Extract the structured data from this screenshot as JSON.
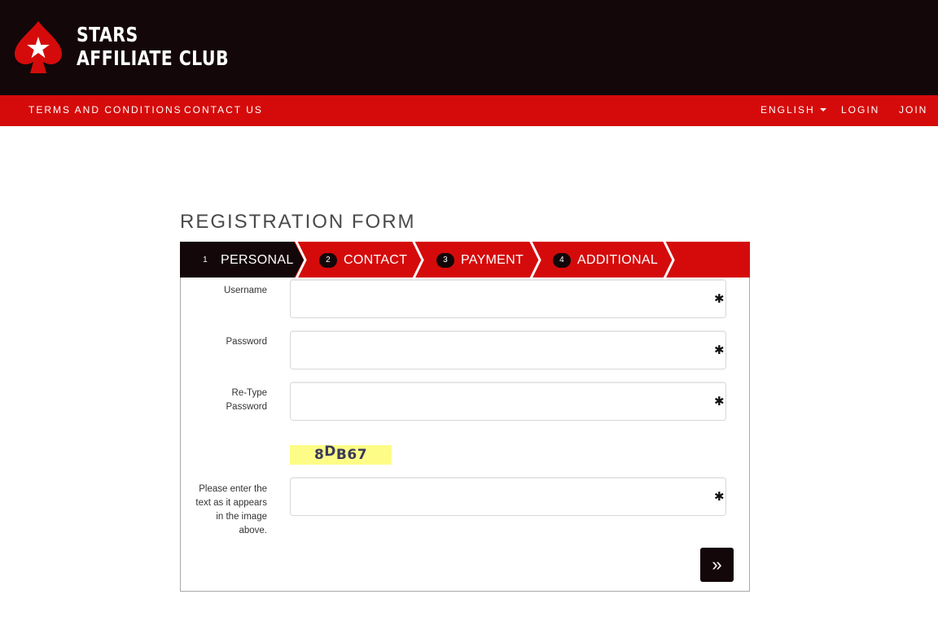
{
  "brand": {
    "line1": "STARS",
    "line2": "AFFILIATE CLUB",
    "logo_icon": "spade-star-icon"
  },
  "colors": {
    "header_bg": "#130709",
    "accent_red": "#d50b0b",
    "captcha_bg": "#fdfc86"
  },
  "nav": {
    "terms": "TERMS AND CONDITIONS",
    "contact": "CONTACT US",
    "language": "ENGLISH",
    "login": "LOGIN",
    "join": "JOIN"
  },
  "form": {
    "title": "REGISTRATION FORM",
    "steps": [
      {
        "number": "1",
        "label": "PERSONAL",
        "active": true
      },
      {
        "number": "2",
        "label": "CONTACT",
        "active": false
      },
      {
        "number": "3",
        "label": "PAYMENT",
        "active": false
      },
      {
        "number": "4",
        "label": "ADDITIONAL",
        "active": false
      }
    ],
    "fields": {
      "username": {
        "label": "Username",
        "value": ""
      },
      "password": {
        "label": "Password",
        "value": ""
      },
      "retype": {
        "label": "Re-Type Password",
        "value": ""
      },
      "captcha_input": {
        "label": "Please enter the text as it appears in the image above.",
        "value": ""
      }
    },
    "required_mark": "✱",
    "captcha": {
      "char1": "8",
      "char2": "D",
      "rest": "B67"
    },
    "next_icon": "»"
  }
}
